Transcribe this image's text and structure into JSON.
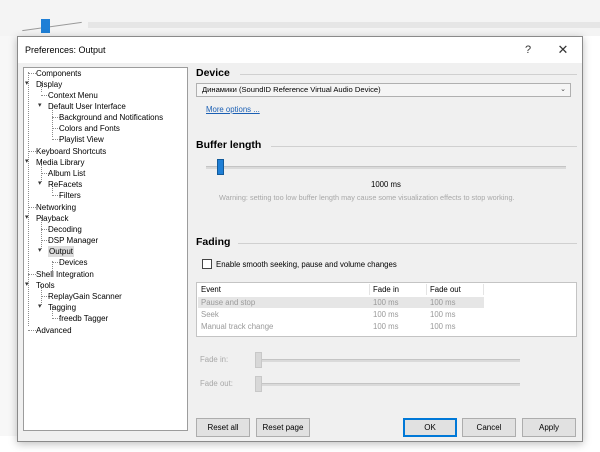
{
  "dialog": {
    "title": "Preferences: Output",
    "help_label": "?",
    "close_label": "✕"
  },
  "tree": {
    "items": [
      {
        "label": "Components"
      },
      {
        "label": "Display"
      },
      {
        "label": "Context Menu"
      },
      {
        "label": "Default User Interface"
      },
      {
        "label": "Background and Notifications"
      },
      {
        "label": "Colors and Fonts"
      },
      {
        "label": "Playlist View"
      },
      {
        "label": "Keyboard Shortcuts"
      },
      {
        "label": "Media Library"
      },
      {
        "label": "Album List"
      },
      {
        "label": "ReFacets"
      },
      {
        "label": "Filters"
      },
      {
        "label": "Networking"
      },
      {
        "label": "Playback"
      },
      {
        "label": "Decoding"
      },
      {
        "label": "DSP Manager"
      },
      {
        "label": "Output"
      },
      {
        "label": "Devices"
      },
      {
        "label": "Shell Integration"
      },
      {
        "label": "Tools"
      },
      {
        "label": "ReplayGain Scanner"
      },
      {
        "label": "Tagging"
      },
      {
        "label": "freedb Tagger"
      },
      {
        "label": "Advanced"
      }
    ],
    "selected": "Output"
  },
  "device": {
    "title": "Device",
    "selected": "Динамики (SoundID Reference Virtual Audio Device)",
    "more_options": "More options ..."
  },
  "buffer": {
    "title": "Buffer length",
    "value": "1000 ms",
    "slider_fraction": 0.03,
    "warning": "Warning: setting too low buffer length may cause some visualization effects to stop working."
  },
  "fading": {
    "title": "Fading",
    "checkbox_label": "Enable smooth seeking, pause and volume changes",
    "checked": false,
    "columns": [
      "Event",
      "Fade in",
      "Fade out"
    ],
    "rows": [
      [
        "Pause and stop",
        "100 ms",
        "100 ms"
      ],
      [
        "Seek",
        "100 ms",
        "100 ms"
      ],
      [
        "Manual track change",
        "100 ms",
        "100 ms"
      ]
    ],
    "fade_in_label": "Fade in:",
    "fade_out_label": "Fade out:"
  },
  "buttons": {
    "reset_all": "Reset all",
    "reset_page": "Reset page",
    "ok": "OK",
    "cancel": "Cancel",
    "apply": "Apply"
  },
  "colors": {
    "accent": "#1f7fd6",
    "link": "#1a5fb4",
    "dialog_bg": "#f0f0f0"
  }
}
